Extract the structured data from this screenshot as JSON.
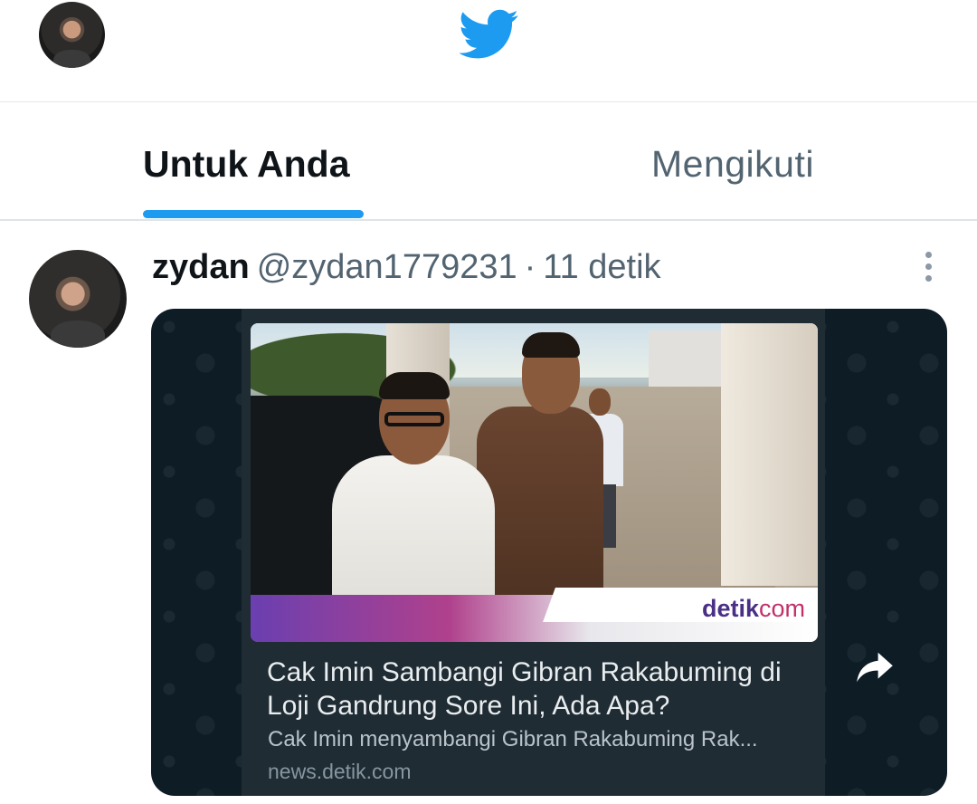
{
  "header": {
    "logo_icon": "twitter-bird-icon",
    "avatar_icon": "user-avatar",
    "brand_color": "#1d9bf0"
  },
  "tabs": [
    {
      "label": "Untuk Anda",
      "active": true
    },
    {
      "label": "Mengikuti",
      "active": false
    }
  ],
  "tweet": {
    "author_name": "zydan",
    "author_handle": "@zydan1779231",
    "separator": "·",
    "timestamp": "11 detik",
    "more_icon": "more-vertical-icon",
    "media": {
      "photo_logo_main": "detik",
      "photo_logo_suffix": "com",
      "link_title": "Cak Imin Sambangi Gibran Rakabuming di Loji Gandrung Sore Ini, Ada Apa?",
      "link_description": "Cak Imin menyambangi Gibran Rakabuming Rak...",
      "link_domain": "news.detik.com",
      "share_icon": "forward-arrow-icon"
    }
  }
}
